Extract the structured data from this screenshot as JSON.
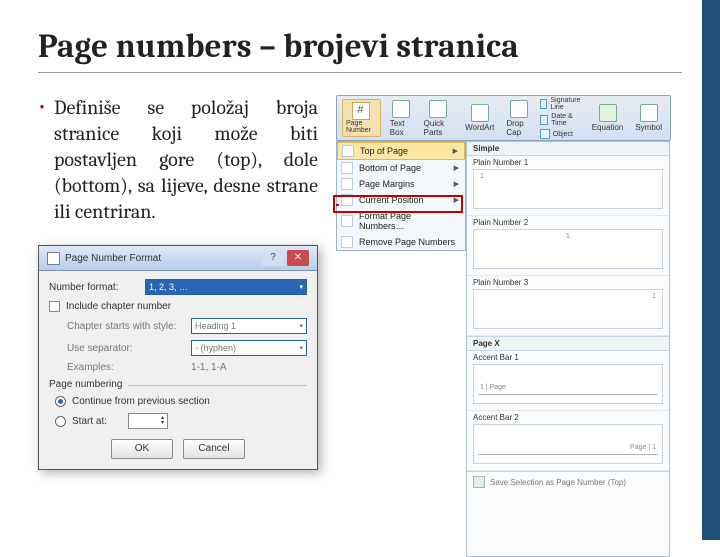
{
  "title": "Page numbers – brojevi stranica",
  "bullet": {
    "text": "Definiše se položaj broja stranice koji može biti postavljen gore (top), dole (bottom), sa lijeve, desne strane ili centriran."
  },
  "ribbon": {
    "page_number": "Page Number",
    "text_box": "Text Box",
    "quick_parts": "Quick Parts",
    "wordart": "WordArt",
    "drop_cap": "Drop Cap",
    "signature_line": "Signature Line",
    "date_time": "Date & Time",
    "object": "Object",
    "equation": "Equation",
    "symbol": "Symbol"
  },
  "menu": {
    "items": [
      "Top of Page",
      "Bottom of Page",
      "Page Margins",
      "Current Position",
      "Format Page Numbers…",
      "Remove Page Numbers"
    ]
  },
  "gallery": {
    "simple": "Simple",
    "items": [
      "Plain Number 1",
      "Plain Number 2",
      "Plain Number 3"
    ],
    "page_x": "Page X",
    "accent1": "Accent Bar 1",
    "accent2": "Accent Bar 2",
    "footer_label": "Save Selection as Page Number (Top)"
  },
  "dialog": {
    "title": "Page Number Format",
    "number_format_label": "Number format:",
    "number_format_value": "1, 2, 3, …",
    "include_chapter": "Include chapter number",
    "chapter_style_label": "Chapter starts with style:",
    "chapter_style_value": "Heading 1",
    "separator_label": "Use separator:",
    "separator_value": "- (hyphen)",
    "examples_label": "Examples:",
    "examples_value": "1-1, 1-A",
    "page_numbering": "Page numbering",
    "continue": "Continue from previous section",
    "start_at": "Start at:",
    "ok": "OK",
    "cancel": "Cancel"
  }
}
